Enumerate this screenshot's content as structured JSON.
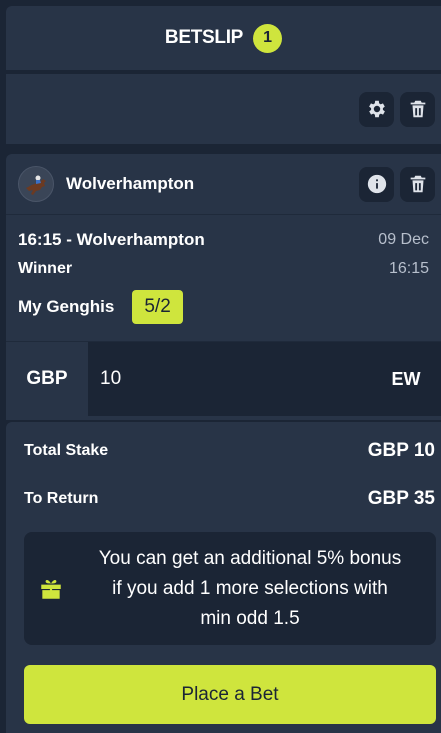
{
  "header": {
    "title": "BETSLIP",
    "count": "1"
  },
  "toolbar": {
    "settings_icon": "gear-icon",
    "delete_icon": "trash-icon"
  },
  "selection": {
    "event": "Wolverhampton",
    "race": "16:15 - Wolverhampton",
    "date": "09 Dec",
    "market": "Winner",
    "time": "16:15",
    "runner": "My Genghis",
    "odds": "5/2",
    "currency": "GBP",
    "stake": "10",
    "each_way": "EW"
  },
  "summary": {
    "total_stake_label": "Total Stake",
    "total_stake_value": "GBP 10",
    "to_return_label": "To Return",
    "to_return_value": "GBP 35"
  },
  "bonus": {
    "line1": "You can get an additional 5% bonus",
    "line2": "if you add 1 more selections with",
    "line3": "min odd 1.5"
  },
  "place_bet_label": "Place a Bet",
  "colors": {
    "accent": "#cfe53d",
    "background": "#1b2535",
    "panel": "#283447"
  }
}
